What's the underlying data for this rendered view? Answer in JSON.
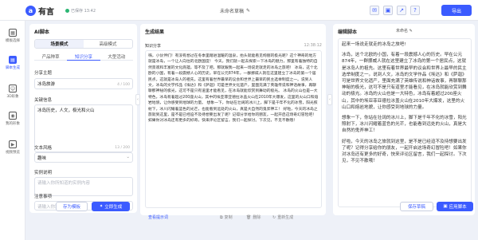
{
  "topbar": {
    "logo_mark": "a",
    "logo_text": "有言",
    "saved_text": "已保存 13:42",
    "doc_title": "未命名草稿",
    "edit_icon": "✎",
    "icons": [
      "message-icon",
      "bookmark-icon",
      "share-icon",
      "help-icon"
    ],
    "export_label": "导出"
  },
  "leftnav": {
    "items": [
      {
        "label": "模板选择",
        "icon": "grid-icon",
        "glyph": "▦"
      },
      {
        "label": "脚本生成",
        "icon": "script-icon",
        "glyph": "▤",
        "active": true
      },
      {
        "label": "3D形象",
        "icon": "avatar-3d-icon",
        "glyph": "☺"
      },
      {
        "label": "我的形象",
        "icon": "my-avatar-icon",
        "glyph": "◉"
      },
      {
        "label": "视频预览",
        "icon": "video-icon",
        "glyph": "▶"
      }
    ]
  },
  "ai": {
    "title": "AI脚本",
    "mode_tabs": [
      "场景模式",
      "高级模式"
    ],
    "sub_tabs": [
      "产品种草",
      "知识分享",
      "大型活动"
    ],
    "topic_label": "分享主题",
    "topic_value": "冰岛旅游",
    "topic_count": "4 / 100",
    "keywords_label": "关键信息",
    "keywords_value": "冰岛历史，人文，极光和火山",
    "keywords_count": "13 / 200",
    "style_label": "文本风格",
    "style_value": "趣味",
    "example_label": "实例说明",
    "example_placeholder": "请输入你所知道的实例内容",
    "notes_label": "注意事项",
    "notes_placeholder": "请输入你需要注意的事项",
    "save_template": "存为模板",
    "generate": "立即生成"
  },
  "gen": {
    "title": "生成结果",
    "item_title": "知识分享",
    "time": "12:38:12",
    "body": "嗨，小伙伴们！有没有想过在冬季里踏进温暖的温泉，抬头就能看见绚丽的极光呢？这个神奇的地方就是冰岛，一个让人向往的北欧国度！ 今天，我们就一起去探索一下冰岛的魅力，那里有着独特的自然景观和丰富的文化底蕴，等不及了吧，那就跟我一起来一场说走就走的冰岛之旅吧！ 冰岛，这个北欧的小国，有着一段震撼人心的历史。早在公元874年，一群挪威人就在这里建立了冰岛的第一个居民点，这就是冰岛人的祖先。这里有着世界最早的议会和世界上最早的民主选举制度之一。说到人文，冰岛的文学作品《埃达》和《萨迦》可是世界文化遗产，里面充满了英雄传说和神话故事，再聊聊那神秘的极光，这可不是只有道里才能看见，在冰岛就能欣赏到舞动的极光。 冰岛的火山也是一大特色，冰岛有着超过200座火山，其中的埃亚菲亚德拉冰盖火山在2010年大爆发，这里的火山口和熔岩地貌，让你感受到地球的力量。 想象一下，你站在壮阔的冰川上，脚下是千年不化的冰雪，阳光照射下，冰川闪耀着蓝色的光芒，也能看到远处的火山，真是大自然的鬼斧神工！ 好啦，今天的冰岛之旅就到这里，是不是已经迫不及待想要出发了呢？记得分享给你的朋友，一起开启这场奇幻冒险吧！如果你对冰岛还有更多的好奇，快来评论区留言，我们一起探讨。下次见，不见不散哦！",
    "view_prompt": "查看提示词",
    "copy": "复制",
    "delete": "删除",
    "regenerate": "重新生成"
  },
  "edit": {
    "title": "编辑脚本",
    "name": "未命名",
    "paragraphs": [
      "起来一场说走就走的冰岛之旅吧!",
      "冰岛，这个北欧的小国，有着一段震撼人心的历史。早在公元874年，一群挪威人就在这里建立了冰岛的第一个居民点，这就是冰岛人的祖先。这里有着世界最早的议会和世界上最早的民主选举制度之一。说到人文，冰岛的文学作品《埃达》和《萨迦》可是世界文化遗产，里面充满了英雄传说和神话故事，再聊聊那神秘的极光，这可不是只有道里才能看见，在冰岛就能欣赏到舞动的极光。冰岛的火山也是一大特色，冰岛有着超过200座火山，其中的埃亚菲亚德拉冰盖火山在2010年大爆发，这里的火山口和熔岩地貌，让你感受到地球的力量。",
      "想象一下，你站在壮阔的冰川上，脚下是千年不化的冰雪，阳光照射下，冰川闪耀着蓝色的光芒，也能看到远处的火山，真是大自然的鬼斧神工！",
      "好啦，今天的冰岛之旅就到这里，是不是已经迫不及待想要出发了呢？记得分享给你的朋友，一起开启这场奇幻冒险吧！如果你对冰岛还有更多的好奇，快来评论区留言，我们一起探讨。下次见，不见不散哦！"
    ],
    "save_draft": "保存草稿",
    "apply": "应用脚本"
  },
  "colors": {
    "accent": "#3b5bff",
    "saved_dot": "#2bb673",
    "background": "#eef1f8"
  }
}
